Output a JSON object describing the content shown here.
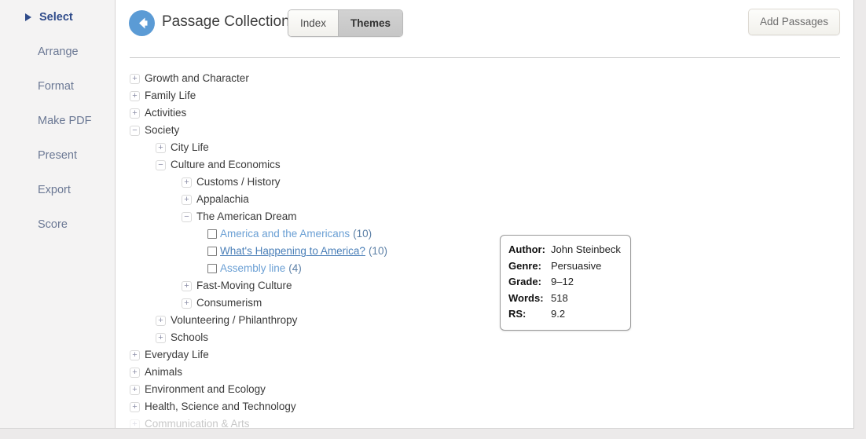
{
  "sidebar": {
    "items": [
      {
        "label": "Select",
        "active": true
      },
      {
        "label": "Arrange",
        "active": false
      },
      {
        "label": "Format",
        "active": false
      },
      {
        "label": "Make PDF",
        "active": false
      },
      {
        "label": "Present",
        "active": false
      },
      {
        "label": "Export",
        "active": false
      },
      {
        "label": "Score",
        "active": false
      }
    ]
  },
  "header": {
    "back_icon": "back-arrow-icon",
    "title": "Passage Collection",
    "tabs": [
      {
        "label": "Index",
        "active": false
      },
      {
        "label": "Themes",
        "active": true
      }
    ],
    "add_passages_label": "Add Passages"
  },
  "tree": {
    "expand_glyph": "+",
    "collapse_glyph": "−",
    "nodes": [
      {
        "label": "Growth and Character",
        "level": 0,
        "state": "collapsed",
        "type": "node"
      },
      {
        "label": "Family Life",
        "level": 0,
        "state": "collapsed",
        "type": "node"
      },
      {
        "label": "Activities",
        "level": 0,
        "state": "collapsed",
        "type": "node"
      },
      {
        "label": "Society",
        "level": 0,
        "state": "expanded",
        "type": "node"
      },
      {
        "label": "City Life",
        "level": 1,
        "state": "collapsed",
        "type": "node"
      },
      {
        "label": "Culture and Economics",
        "level": 1,
        "state": "expanded",
        "type": "node"
      },
      {
        "label": "Customs / History",
        "level": 2,
        "state": "collapsed",
        "type": "node"
      },
      {
        "label": "Appalachia",
        "level": 2,
        "state": "collapsed",
        "type": "node"
      },
      {
        "label": "The American Dream",
        "level": 2,
        "state": "expanded",
        "type": "node"
      },
      {
        "label": "America and the Americans",
        "count": "(10)",
        "level": 3,
        "type": "passage",
        "checked": false,
        "hover": false
      },
      {
        "label": "What's Happening to America?",
        "count": "(10)",
        "level": 3,
        "type": "passage",
        "checked": false,
        "hover": true
      },
      {
        "label": "Assembly line",
        "count": "(4)",
        "level": 3,
        "type": "passage",
        "checked": false,
        "hover": false
      },
      {
        "label": "Fast-Moving Culture",
        "level": 2,
        "state": "collapsed",
        "type": "node"
      },
      {
        "label": "Consumerism",
        "level": 2,
        "state": "collapsed",
        "type": "node"
      },
      {
        "label": "Volunteering / Philanthropy",
        "level": 1,
        "state": "collapsed",
        "type": "node"
      },
      {
        "label": "Schools",
        "level": 1,
        "state": "collapsed",
        "type": "node"
      },
      {
        "label": "Everyday Life",
        "level": 0,
        "state": "collapsed",
        "type": "node"
      },
      {
        "label": "Animals",
        "level": 0,
        "state": "collapsed",
        "type": "node"
      },
      {
        "label": "Environment and Ecology",
        "level": 0,
        "state": "collapsed",
        "type": "node"
      },
      {
        "label": "Health, Science and Technology",
        "level": 0,
        "state": "collapsed",
        "type": "node"
      },
      {
        "label": "Communication & Arts",
        "level": 0,
        "state": "collapsed",
        "type": "node",
        "faded": true
      }
    ]
  },
  "tooltip": {
    "rows": [
      {
        "key": "Author:",
        "value": "John Steinbeck"
      },
      {
        "key": "Genre:",
        "value": "Persuasive"
      },
      {
        "key": "Grade:",
        "value": "9–12"
      },
      {
        "key": "Words:",
        "value": "518"
      },
      {
        "key": "RS:",
        "value": "9.2"
      }
    ]
  },
  "colors": {
    "accent_blue": "#5b9bd5",
    "link_blue": "#6a9fd4",
    "sidebar_active": "#2f4b8a",
    "sidebar_text": "#6b7894"
  }
}
